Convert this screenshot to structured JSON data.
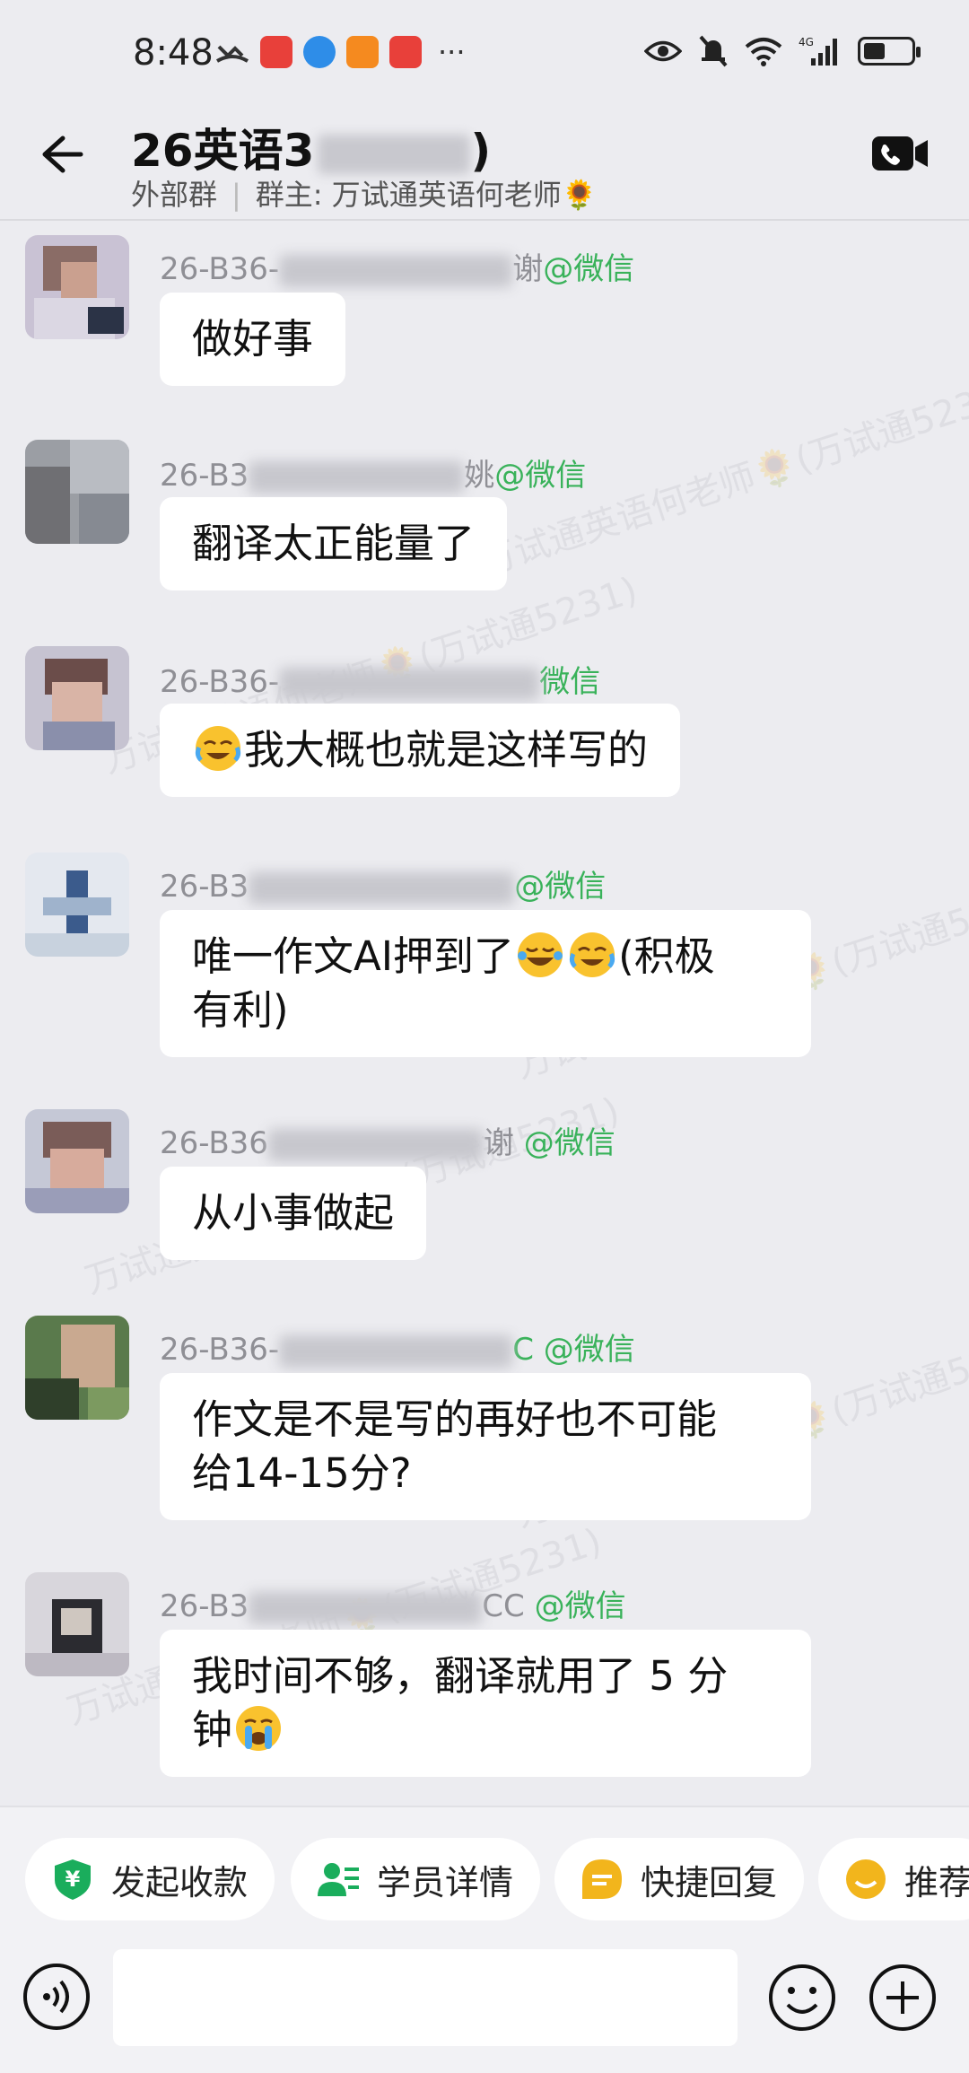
{
  "status_bar": {
    "time": "8:48",
    "more": "···",
    "network": "4G",
    "battery_percent": 45
  },
  "header": {
    "title": "26英语3",
    "title_suffix": ")",
    "group_type": "外部群",
    "owner": "群主: 万试通英语何老师🌻"
  },
  "watermark_text": "万试通英语何老师🌻(万试通5231)",
  "messages": [
    {
      "sender_prefix": "26-B36-",
      "sender_suffix": "谢",
      "source": "@微信",
      "lines": [
        "做好事"
      ]
    },
    {
      "sender_prefix": "26-B3",
      "sender_suffix": "姚",
      "source": "@微信",
      "lines": [
        "翻译太正能量了"
      ]
    },
    {
      "sender_prefix": "26-B36-",
      "sender_suffix": "",
      "source": "微信",
      "lines": [
        "我大概也就是这样写的"
      ],
      "lead_emoji": "cry-laugh-emoji"
    },
    {
      "sender_prefix": "26-B3",
      "sender_suffix": "",
      "source": "@微信",
      "lines": [
        "唯一作文AI押到了",
        "(积极",
        "有利)"
      ],
      "emojis": [
        "laugh-tears-emoji",
        "cry-laugh-emoji"
      ]
    },
    {
      "sender_prefix": "26-B36",
      "sender_suffix": "谢",
      "source": "@微信",
      "lines": [
        "从小事做起"
      ]
    },
    {
      "sender_prefix": "26-B36-",
      "sender_suffix": "",
      "source": "C @微信",
      "lines": [
        "作文是不是写的再好也不可能",
        "给14-15分?"
      ]
    },
    {
      "sender_prefix": "26-B3",
      "sender_suffix": "CC",
      "source": "@微信",
      "lines": [
        "我时间不够，翻译就用了 5 分",
        "钟"
      ],
      "tail_emoji": "crying-emoji"
    }
  ],
  "quick_actions": [
    {
      "label": "发起收款",
      "icon": "payment-shield-icon",
      "color": "#1aad5c"
    },
    {
      "label": "学员详情",
      "icon": "student-profile-icon",
      "color": "#1aad5c"
    },
    {
      "label": "快捷回复",
      "icon": "quick-reply-icon",
      "color": "#f2b51c"
    },
    {
      "label": "推荐",
      "icon": "recommend-icon",
      "color": "#f2b51c"
    }
  ],
  "input": {
    "placeholder": ""
  },
  "colors": {
    "accent_green": "#39b25a",
    "background": "#ececf0"
  }
}
